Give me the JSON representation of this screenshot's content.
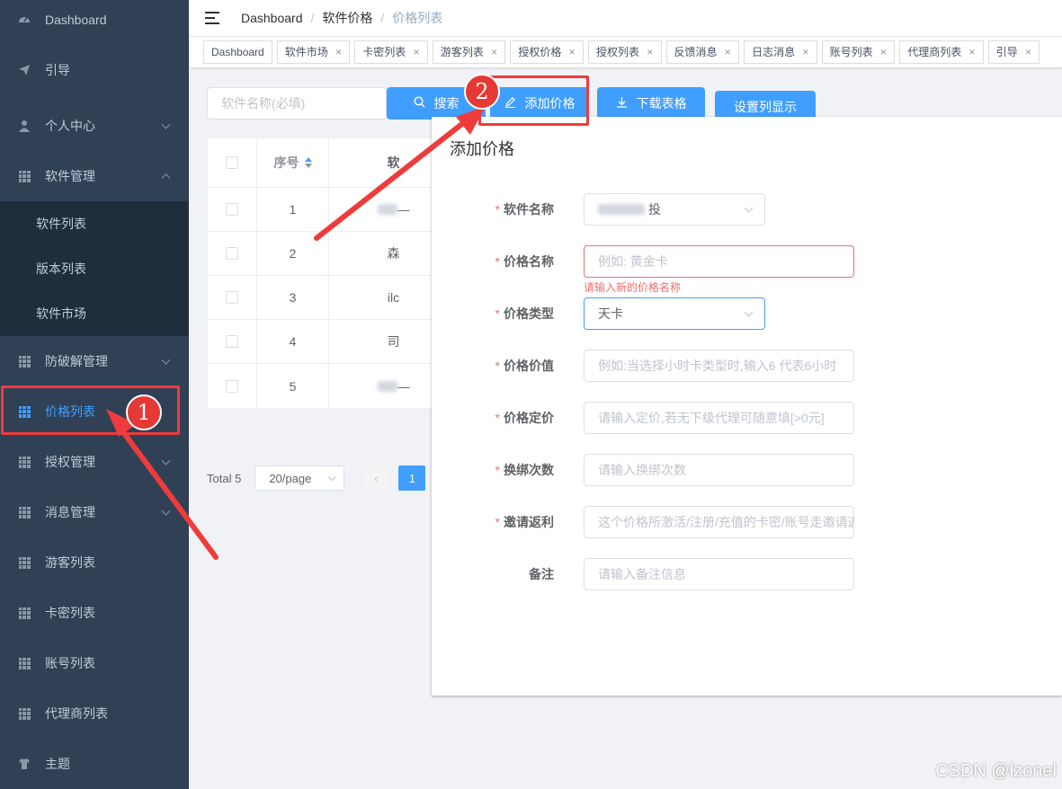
{
  "sidebar": {
    "items": [
      {
        "label": "Dashboard",
        "icon": "dashboard-icon"
      },
      {
        "label": "引导",
        "icon": "send-icon"
      },
      {
        "label": "个人中心",
        "icon": "user-icon"
      },
      {
        "label": "软件管理",
        "icon": "table-icon"
      },
      {
        "label": "防破解管理",
        "icon": "table-icon"
      },
      {
        "label": "价格列表",
        "icon": "table-icon"
      },
      {
        "label": "授权管理",
        "icon": "table-icon"
      },
      {
        "label": "消息管理",
        "icon": "table-icon"
      },
      {
        "label": "游客列表",
        "icon": "table-icon"
      },
      {
        "label": "卡密列表",
        "icon": "table-icon"
      },
      {
        "label": "账号列表",
        "icon": "table-icon"
      },
      {
        "label": "代理商列表",
        "icon": "table-icon"
      },
      {
        "label": "主题",
        "icon": "shirt-icon"
      }
    ],
    "software_sub": [
      "软件列表",
      "版本列表",
      "软件市场"
    ],
    "active_color": "#409eff"
  },
  "breadcrumb": [
    "Dashboard",
    "软件价格",
    "价格列表"
  ],
  "tags": [
    "Dashboard",
    "软件市场",
    "卡密列表",
    "游客列表",
    "授权价格",
    "授权列表",
    "反馈消息",
    "日志消息",
    "账号列表",
    "代理商列表",
    "引导"
  ],
  "toolbar": {
    "search_placeholder": "软件名称(必填)",
    "search_label": "搜索",
    "add_label": "添加价格",
    "download_label": "下载表格",
    "columns_label": "设置列显示"
  },
  "table": {
    "col_index": "序号",
    "col_name_partial": "软",
    "rows": [
      {
        "index": "1",
        "name": "—"
      },
      {
        "index": "2",
        "name": "森"
      },
      {
        "index": "3",
        "name": "ilc"
      },
      {
        "index": "4",
        "name": "司"
      },
      {
        "index": "5",
        "name": "—"
      }
    ]
  },
  "pager": {
    "total": "Total 5",
    "size": "20/page",
    "page": "1"
  },
  "dialog": {
    "title": "添加价格",
    "fields": [
      {
        "label": "软件名称",
        "required": true,
        "value": "投",
        "type": "select"
      },
      {
        "label": "价格名称",
        "required": true,
        "placeholder": "例如: 黄金卡",
        "error": "请输入新的价格名称"
      },
      {
        "label": "价格类型",
        "required": true,
        "value": "天卡",
        "type": "select"
      },
      {
        "label": "价格价值",
        "required": true,
        "placeholder": "例如:当选择小时卡类型时,输入6 代表6小时"
      },
      {
        "label": "价格定价",
        "required": true,
        "placeholder": "请输入定价,若无下级代理可随意填[>0元]"
      },
      {
        "label": "换绑次数",
        "required": true,
        "placeholder": "请输入换绑次数"
      },
      {
        "label": "邀请返利",
        "required": true,
        "placeholder": "这个价格所激活/注册/充值的卡密/账号走邀请返利"
      },
      {
        "label": "备注",
        "required": false,
        "placeholder": "请输入备注信息"
      }
    ]
  },
  "annotations": {
    "badge1": "1",
    "badge2": "2"
  },
  "watermark": "CSDN @lzonel"
}
